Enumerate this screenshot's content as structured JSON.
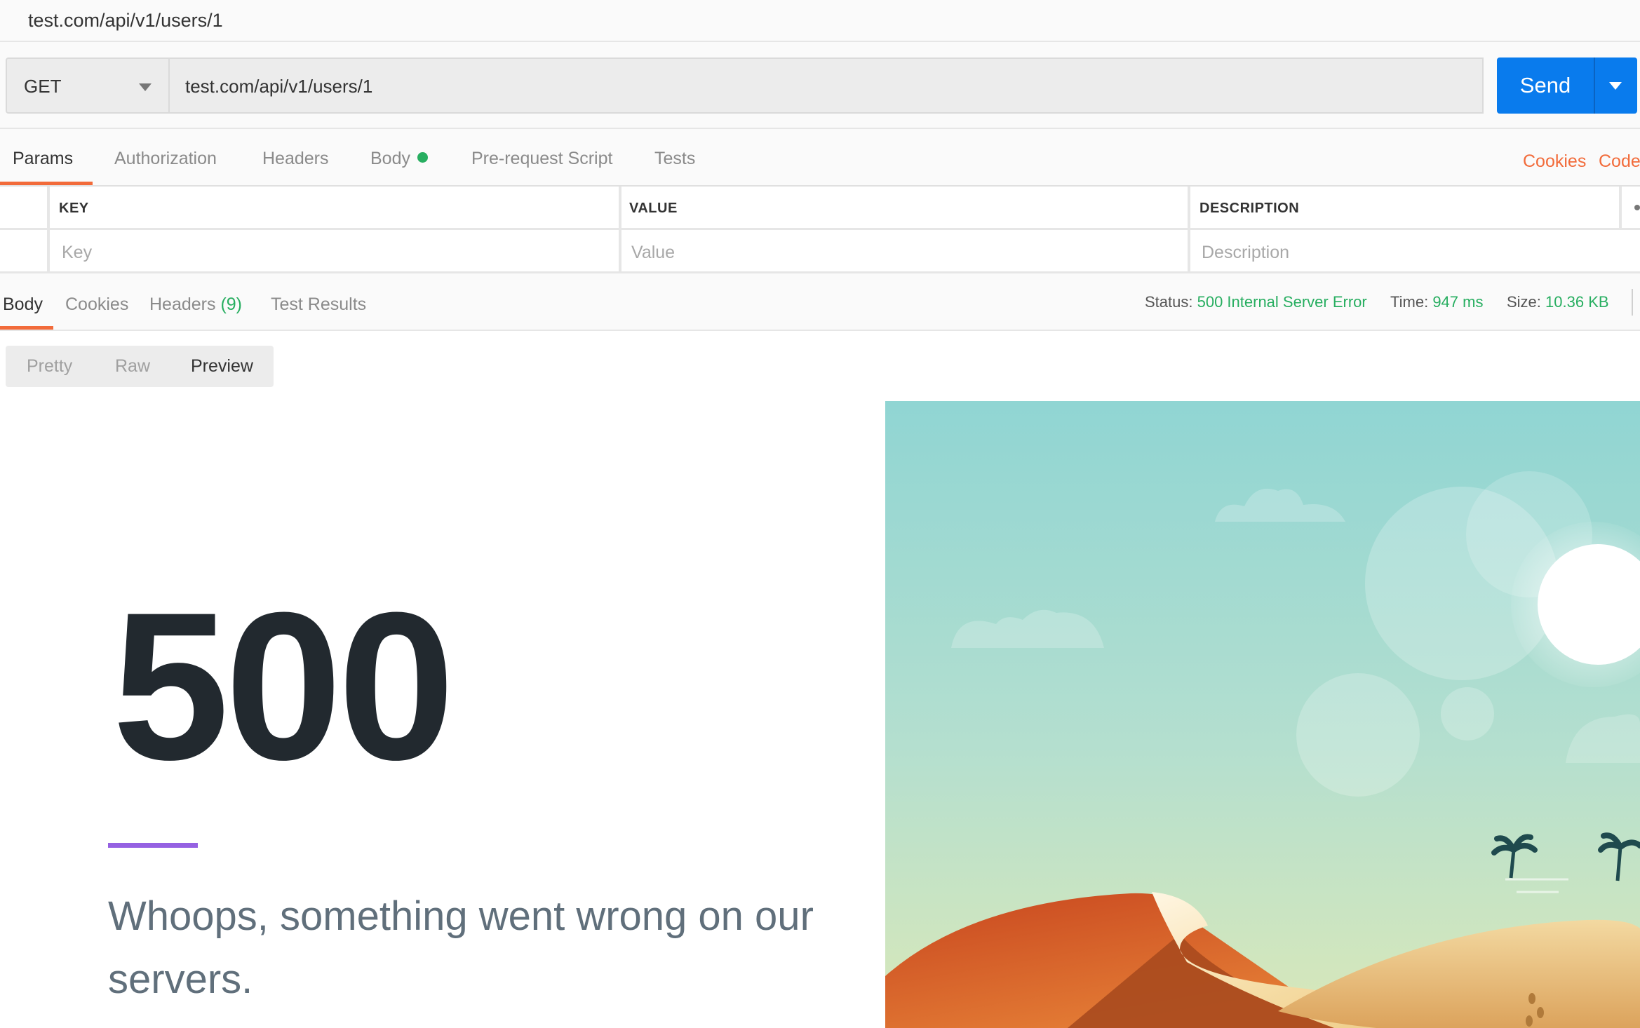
{
  "tab_title": "test.com/api/v1/users/1",
  "request": {
    "method": "GET",
    "url": "test.com/api/v1/users/1",
    "send_label": "Send"
  },
  "request_tabs": {
    "params": "Params",
    "authorization": "Authorization",
    "headers": "Headers",
    "body": "Body",
    "pre_request_script": "Pre-request Script",
    "tests": "Tests",
    "cookies": "Cookies",
    "code": "Code"
  },
  "params_table": {
    "headers": [
      "KEY",
      "VALUE",
      "DESCRIPTION"
    ],
    "placeholders": [
      "Key",
      "Value",
      "Description"
    ]
  },
  "response_tabs": {
    "body": "Body",
    "cookies": "Cookies",
    "headers": "Headers",
    "headers_count": "(9)",
    "test_results": "Test Results"
  },
  "response_stats": {
    "status_label": "Status:",
    "status_value": "500 Internal Server Error",
    "time_label": "Time:",
    "time_value": "947 ms",
    "size_label": "Size:",
    "size_value": "10.36 KB"
  },
  "view_modes": {
    "pretty": "Pretty",
    "raw": "Raw",
    "preview": "Preview",
    "selected": "Preview"
  },
  "preview": {
    "code": "500",
    "message": "Whoops, something went wrong on our servers."
  },
  "colors": {
    "accent_orange": "#f26b3a",
    "send_blue": "#097bed",
    "status_green": "#27ae60",
    "purple": "#9561e2"
  }
}
